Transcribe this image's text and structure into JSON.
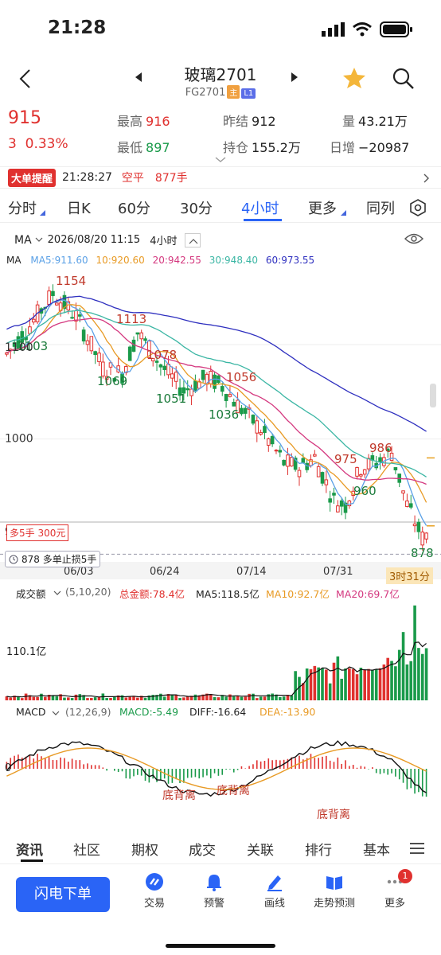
{
  "status": {
    "time": "21:28"
  },
  "header": {
    "title": "玻璃2701",
    "code": "FG2701",
    "tag_main": "主",
    "tag_level": "L1"
  },
  "quote": {
    "last": "915",
    "change": "3",
    "change_pct": "0.33%",
    "high_label": "最高",
    "high": "916",
    "low_label": "最低",
    "low": "897",
    "prev_label": "昨结",
    "prev": "912",
    "oi_label": "持仓",
    "oi": "155.2万",
    "vol_label": "量",
    "vol": "43.21万",
    "daily_label": "日增",
    "daily": "−20987"
  },
  "alert": {
    "badge": "大单提醒",
    "time": "21:28:27",
    "action": "空平",
    "qty": "877手"
  },
  "tabs": [
    "分时",
    "日K",
    "60分",
    "30分",
    "4小时",
    "更多",
    "同列"
  ],
  "active_tab": "4小时",
  "chart_info": {
    "ma": "MA",
    "datetime": "2026/08/20 11:15",
    "period": "4小时"
  },
  "ma_legend": {
    "label": "MA",
    "ma5": "MA5:911.60",
    "ma10": "10:920.60",
    "ma20": "20:942.55",
    "ma30": "30:948.40",
    "ma60": "60:973.55"
  },
  "colors": {
    "ma5": "#5aa0e6",
    "ma10": "#e89a24",
    "ma20": "#d4387f",
    "ma30": "#3bb6a4",
    "ma60": "#2e2fbf",
    "up": "#e0312f",
    "down": "#1a9a4a"
  },
  "price_annotations": [
    "1154",
    "1103",
    "1113",
    "1069",
    "1078",
    "1051",
    "1056",
    "1036",
    "975",
    "986",
    "960",
    "878"
  ],
  "price_axis": [
    "1100",
    "1000",
    "900"
  ],
  "position_label": "多5手 300元",
  "stop_label": "878 多单止损5手",
  "date_axis": [
    "06/03",
    "06/24",
    "07/14",
    "07/31"
  ],
  "countdown": "3时31分",
  "volume": {
    "label": "成交额",
    "params": "(5,10,20)",
    "total": "总金额:78.4亿",
    "ma5": "MA5:118.5亿",
    "ma10": "MA10:92.7亿",
    "ma20": "MA20:69.7亿",
    "axis": "110.1亿"
  },
  "macd": {
    "label": "MACD",
    "params": "(12,26,9)",
    "macd": "MACD:-5.49",
    "diff": "DIFF:-16.64",
    "dea": "DEA:-13.90",
    "axis": "0",
    "divergence": [
      "底背离",
      "底背离",
      "底背离"
    ]
  },
  "bottom_tabs": [
    "资讯",
    "社区",
    "期权",
    "成交",
    "关联",
    "排行",
    "基本"
  ],
  "toolbar": {
    "flash": "闪电下单",
    "items": [
      "交易",
      "预警",
      "画线",
      "走势预测",
      "更多"
    ],
    "badge": "1"
  }
}
